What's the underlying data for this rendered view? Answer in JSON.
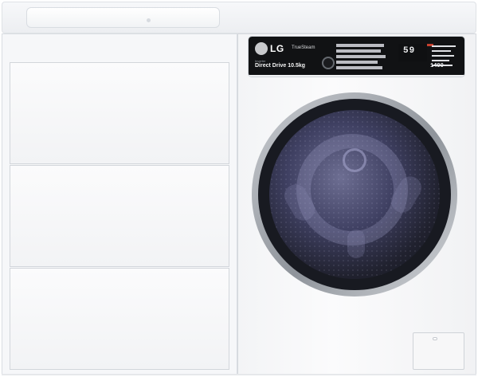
{
  "brand": {
    "logo_text": "LG",
    "steam_text": "TrueSteam",
    "inverter_text": "Inverter",
    "drive_text": "Direct Drive 10.5kg"
  },
  "control_panel": {
    "display_digits": "59",
    "spin_value": "1400"
  },
  "colors": {
    "panel_black": "#111214",
    "glass": "#3f4062",
    "door_trim": "#a0a4aa",
    "cabinet": "#f6f7f9",
    "accent_red": "#c8412f"
  },
  "icons": {
    "program_knob": "dial-icon",
    "door": "porthole-door"
  }
}
